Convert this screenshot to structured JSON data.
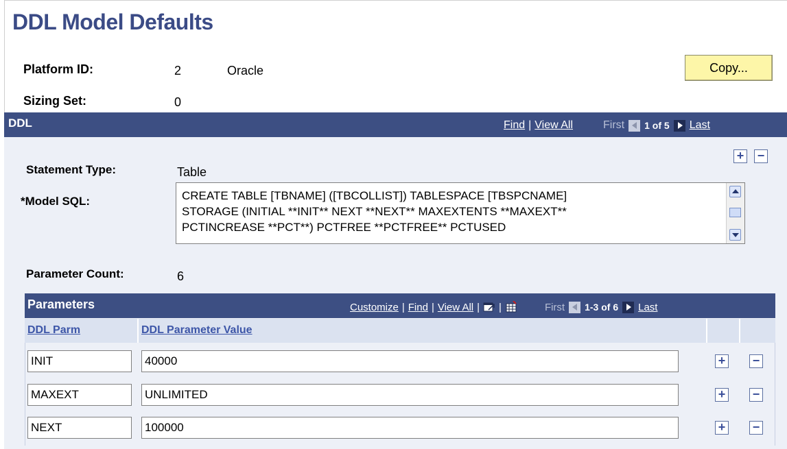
{
  "page": {
    "title": "DDL Model Defaults"
  },
  "header_fields": {
    "platform_id_label": "Platform ID:",
    "platform_id_value": "2",
    "platform_name": "Oracle",
    "sizing_set_label": "Sizing Set:",
    "sizing_set_value": "0",
    "copy_button": "Copy..."
  },
  "ddl_grid": {
    "title": "DDL",
    "find": "Find",
    "view_all": "View All",
    "first": "First",
    "range": "1 of 5",
    "last": "Last",
    "statement_type_label": "Statement Type:",
    "statement_type_value": "Table",
    "model_sql_label": "*Model SQL:",
    "model_sql_value": "CREATE TABLE [TBNAME] ([TBCOLLIST]) TABLESPACE [TBSPCNAME]\nSTORAGE (INITIAL **INIT** NEXT **NEXT** MAXEXTENTS **MAXEXT**\nPCTINCREASE **PCT**) PCTFREE **PCTFREE** PCTUSED",
    "parameter_count_label": "Parameter Count:",
    "parameter_count_value": "6"
  },
  "params_grid": {
    "title": "Parameters",
    "customize": "Customize",
    "find": "Find",
    "view_all": "View All",
    "first": "First",
    "range": "1-3 of 6",
    "last": "Last",
    "columns": [
      "DDL Parm",
      "DDL Parameter Value"
    ],
    "rows": [
      {
        "parm": "INIT",
        "value": "40000"
      },
      {
        "parm": "MAXEXT",
        "value": "UNLIMITED"
      },
      {
        "parm": "NEXT",
        "value": "100000"
      }
    ]
  },
  "colors": {
    "header_bg": "#3d4f83",
    "body_bg": "#edf0f7",
    "title": "#3b4b86",
    "button_bg": "#fdf6a8"
  },
  "icons": [
    "add-row-icon",
    "delete-row-icon",
    "prev-arrow-icon",
    "next-arrow-icon",
    "new-window-icon",
    "download-spreadsheet-icon"
  ]
}
